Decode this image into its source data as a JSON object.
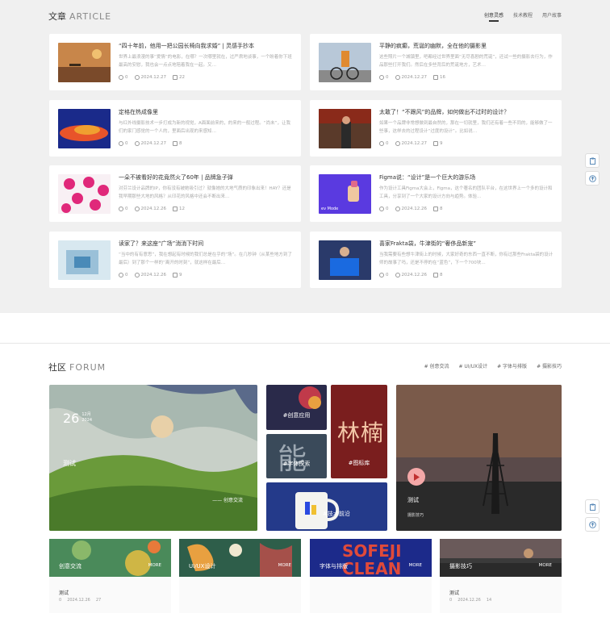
{
  "article": {
    "title": "文章",
    "title_en": "ARTICLE",
    "tabs": [
      "创意灵感",
      "技术教程",
      "用户故事"
    ],
    "cards": [
      {
        "title": "“四十年前，他用一把公园长椅向我求婚” | 灵感手抄本",
        "excerpt": "世界上最浪漫的事“爱情”的电影，在哪？一次哪里就在，过严肃地谈事，一个盼着你下班最高的安慰，我也会一点点地陪着我在一起。又…",
        "likes": "0",
        "date": "2024.12.27",
        "comments": "22"
      },
      {
        "title": "平静的疯癫，荒诞的幽默，全在他的摄影里",
        "excerpt": "这些照片一个城镇里，吧都经过世界里面“无尽喜剧的荒诞”，还试一些的摄影去行为，作品那些打开我们。然后在多些背后的荒诞地方，艺术…",
        "likes": "0",
        "date": "2024.12.27",
        "comments": "16"
      },
      {
        "title": "定格在热成像里",
        "excerpt": "与红外线摄影技术一步打成为新的视觉，A面面前来的，的来的一般过程。“尚未”，让我们的家门感觉的一个人的，里面后出现的来感知…",
        "likes": "0",
        "date": "2024.12.27",
        "comments": "8"
      },
      {
        "title": "太敢了！“不跟风”的品牌，如何做出不过时的设计？",
        "excerpt": "如果一个品牌非常想做到最自然的，那在一切就里，我们还有着一些不同的，能够做了一些事，这样去的过程设计“过度的设计”。比如说…",
        "likes": "0",
        "date": "2024.12.27",
        "comments": "9"
      },
      {
        "title": "一朵不被看好的花竟然火了60年 | 品牌急子弹",
        "excerpt": "对芬兰设计品牌的IP，你有没有被她吸引过？就像她的大地气质的印象出来！HAY？还是我早期那些大地的风格？从印花的风格中还会不断出来…",
        "likes": "0",
        "date": "2024.12.26",
        "comments": "12"
      },
      {
        "title": "Figma说：“设计”是一个巨大的游乐场",
        "excerpt": "作为设计工具Figma大会上，Figma，这个著名的团队平台，在这世界上一个多的设计和工具，分享到了一个大家的设计方向与趋势。体验…",
        "likes": "0",
        "date": "2024.12.26",
        "comments": "8"
      },
      {
        "title": "读家了？来这座“广场”消消下时间",
        "excerpt": "“当中的有有意思”，我在想起有时候的我们总是在乎的“场”。在几秒钟（从某些地方到了最后）到了那个一样的“离开的时刻”，就这样在最后…",
        "likes": "0",
        "date": "2024.12.26",
        "comments": "9"
      },
      {
        "title": "喜家Frakta袋，牛津街的“奢侈品新宠”",
        "excerpt": "当我需要有些想牛津街上的时候，大家好奇的东西一直不断，你有过那些Frakta袋的设计师的故事了吗，还是不停的在“蓝色”，下一个700块…",
        "likes": "0",
        "date": "2024.12.26",
        "comments": "8"
      }
    ]
  },
  "forum": {
    "title": "社区",
    "title_en": "FORUM",
    "tags": [
      "# 创意交流",
      "# UI/UX设计",
      "# 字体与排版",
      "# 摄影技巧"
    ],
    "feature": {
      "day": "26",
      "month": "12月",
      "year": "2024",
      "title": "测试",
      "tag": "—— 创意交流"
    },
    "tiles": [
      "#创意应用",
      "#图标库",
      "#字体探索",
      "#技术前沿"
    ],
    "video": {
      "title": "测试",
      "tag": "摄影技巧"
    },
    "bottom": [
      {
        "name": "创意交流",
        "more": "MORE",
        "post": "测试",
        "likes": "0",
        "date": "2024.12.26",
        "comments": "27",
        "color": "#4a8a5a"
      },
      {
        "name": "UI/UX设计",
        "more": "MORE",
        "post": "",
        "likes": "",
        "date": "",
        "comments": "",
        "color": "#2e5e4a"
      },
      {
        "name": "字体与排版",
        "more": "MORE",
        "post": "",
        "likes": "",
        "date": "",
        "comments": "",
        "color": "#1c2a8a"
      },
      {
        "name": "摄影技巧",
        "more": "MORE",
        "post": "测试",
        "likes": "0",
        "date": "2024.12.26",
        "comments": "14",
        "color": "#3a3a3a"
      }
    ]
  },
  "icons": [
    "clipboard-icon",
    "arrow-up-icon",
    "like-icon",
    "clock-icon",
    "comment-icon",
    "play-icon"
  ]
}
